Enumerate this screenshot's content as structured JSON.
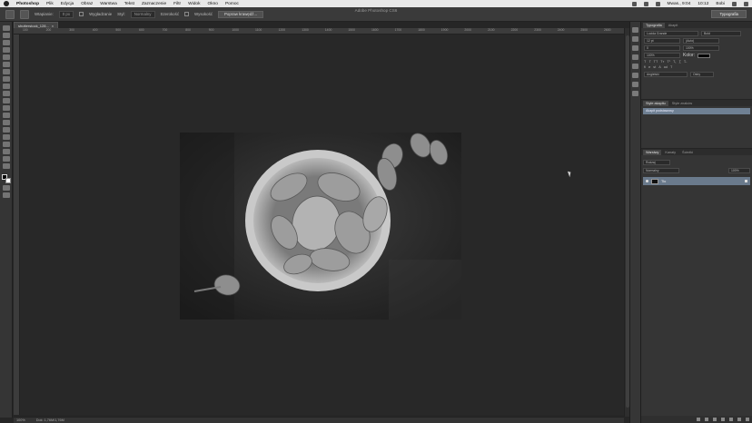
{
  "menubar": {
    "app": "Photoshop",
    "items": [
      "Plik",
      "Edycja",
      "Obraz",
      "Warstwa",
      "Tekst",
      "Zaznaczenie",
      "Filtr",
      "Widok",
      "Okno",
      "Pomoc"
    ],
    "clock": "Mwas., 9:04",
    "time": "10:12",
    "user": "Bobi"
  },
  "window": {
    "title": "Adobe Photoshop CS6"
  },
  "options": {
    "mode_label": "Wtapianie:",
    "mode_value": "0 px",
    "smooth": "Wygładzanie",
    "style_label": "Styl:",
    "style_value": "Normalny",
    "width_label": "Szerokość",
    "height_label": "Wysokość",
    "refine_button": "Popraw krawędź...",
    "workspace": "Typografia"
  },
  "document": {
    "tab": "shutterstock_128...",
    "zoom": "100%",
    "info": "Dok: 1,76M/1,76M"
  },
  "ruler": {
    "marks": [
      "100",
      "200",
      "300",
      "400",
      "500",
      "600",
      "700",
      "800",
      "900",
      "1000",
      "1100",
      "1200",
      "1300",
      "1400",
      "1500",
      "1600",
      "1700",
      "1800",
      "1900",
      "2000",
      "2100",
      "2200",
      "2300",
      "2400",
      "2500",
      "2600"
    ]
  },
  "panels": {
    "typography_tabs": [
      "Typografia",
      "Akapit"
    ],
    "font_family": "Lucida Grande",
    "font_style": "Bold",
    "size": "12 pt",
    "leading": "(Auto)",
    "tracking": "0",
    "scale": "100%",
    "color_label": "Kolor:",
    "lang": "Angielski",
    "aa": "Ostry",
    "styles_tabs": [
      "Style akapitu",
      "Style znaków"
    ],
    "styles_item": "Akapit podstawowy",
    "layers_tabs": [
      "Warstwy",
      "Kanały",
      "Ścieżki"
    ],
    "kind": "Rodzaj",
    "blend": "Normalny",
    "opacity": "100%",
    "layer_name": "Tło"
  },
  "colors": {
    "accent_layer": "#6a7a8c",
    "menubar": "#e8e8e8"
  }
}
